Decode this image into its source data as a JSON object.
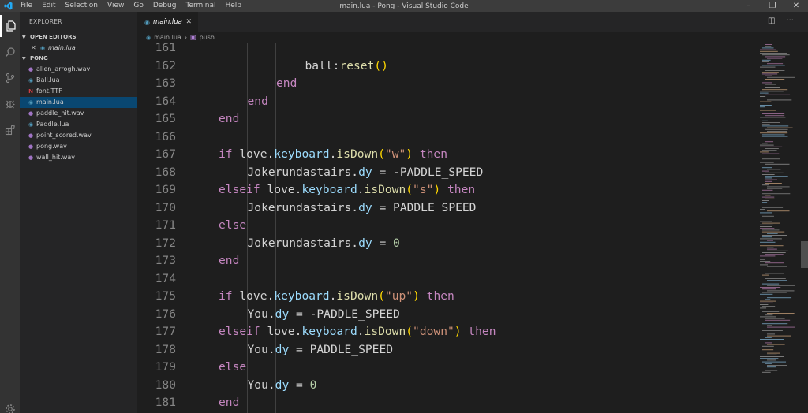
{
  "window": {
    "title": "main.lua - Pong - Visual Studio Code",
    "menu": [
      "File",
      "Edit",
      "Selection",
      "View",
      "Go",
      "Debug",
      "Terminal",
      "Help"
    ]
  },
  "activity_bar": {
    "items": [
      "files-icon",
      "search-icon",
      "source-control-icon",
      "debug-icon",
      "extensions-icon",
      "settings-gear-icon"
    ]
  },
  "sidebar": {
    "title": "EXPLORER",
    "open_editors": {
      "label": "OPEN EDITORS",
      "items": [
        {
          "name": "main.lua",
          "icon": "lua-file-icon"
        }
      ]
    },
    "folder": {
      "label": "PONG",
      "files": [
        {
          "name": "allen_arrogh.wav",
          "icon": "audio-file-icon",
          "selected": false
        },
        {
          "name": "Ball.lua",
          "icon": "lua-file-icon",
          "selected": false
        },
        {
          "name": "font.TTF",
          "icon": "font-file-icon",
          "selected": false
        },
        {
          "name": "main.lua",
          "icon": "lua-file-icon",
          "selected": true
        },
        {
          "name": "paddle_hit.wav",
          "icon": "audio-file-icon",
          "selected": false
        },
        {
          "name": "Paddle.lua",
          "icon": "lua-file-icon",
          "selected": false
        },
        {
          "name": "point_scored.wav",
          "icon": "audio-file-icon",
          "selected": false
        },
        {
          "name": "pong.wav",
          "icon": "audio-file-icon",
          "selected": false
        },
        {
          "name": "wall_hit.wav",
          "icon": "audio-file-icon",
          "selected": false
        }
      ]
    }
  },
  "tabs": [
    {
      "label": "main.lua",
      "active": true
    }
  ],
  "breadcrumb": {
    "file": "main.lua",
    "symbol": "push"
  },
  "editor": {
    "lines": [
      {
        "n": "161",
        "indent": 3,
        "tokens": []
      },
      {
        "n": "162",
        "indent": 3,
        "tokens": [
          [
            "t",
            "ball:"
          ],
          [
            "fnc",
            "reset"
          ],
          [
            "paren",
            "()"
          ]
        ]
      },
      {
        "n": "163",
        "indent": 2,
        "tokens": [
          [
            "kw",
            "end"
          ]
        ]
      },
      {
        "n": "164",
        "indent": 1,
        "tokens": [
          [
            "kw",
            "end"
          ]
        ]
      },
      {
        "n": "165",
        "indent": 0,
        "tokens": [
          [
            "kw",
            "end"
          ]
        ]
      },
      {
        "n": "166",
        "indent": 0,
        "tokens": []
      },
      {
        "n": "167",
        "indent": 0,
        "tokens": [
          [
            "kw",
            "if"
          ],
          [
            "t",
            " love."
          ],
          [
            "prop",
            "keyboard"
          ],
          [
            "t",
            "."
          ],
          [
            "fnc",
            "isDown"
          ],
          [
            "paren",
            "("
          ],
          [
            "str",
            "\"w\""
          ],
          [
            "paren",
            ")"
          ],
          [
            "t",
            " "
          ],
          [
            "kw",
            "then"
          ]
        ]
      },
      {
        "n": "168",
        "indent": 1,
        "tokens": [
          [
            "t",
            "Jokerundastairs."
          ],
          [
            "prop",
            "dy"
          ],
          [
            "t",
            " = -PADDLE_SPEED"
          ]
        ]
      },
      {
        "n": "169",
        "indent": 0,
        "tokens": [
          [
            "kw",
            "elseif"
          ],
          [
            "t",
            " love."
          ],
          [
            "prop",
            "keyboard"
          ],
          [
            "t",
            "."
          ],
          [
            "fnc",
            "isDown"
          ],
          [
            "paren",
            "("
          ],
          [
            "str",
            "\"s\""
          ],
          [
            "paren",
            ")"
          ],
          [
            "t",
            " "
          ],
          [
            "kw",
            "then"
          ]
        ]
      },
      {
        "n": "170",
        "indent": 1,
        "tokens": [
          [
            "t",
            "Jokerundastairs."
          ],
          [
            "prop",
            "dy"
          ],
          [
            "t",
            " = PADDLE_SPEED"
          ]
        ]
      },
      {
        "n": "171",
        "indent": 0,
        "tokens": [
          [
            "kw",
            "else"
          ]
        ]
      },
      {
        "n": "172",
        "indent": 1,
        "tokens": [
          [
            "t",
            "Jokerundastairs."
          ],
          [
            "prop",
            "dy"
          ],
          [
            "t",
            " = "
          ],
          [
            "num",
            "0"
          ]
        ]
      },
      {
        "n": "173",
        "indent": 0,
        "tokens": [
          [
            "kw",
            "end"
          ]
        ]
      },
      {
        "n": "174",
        "indent": 0,
        "tokens": []
      },
      {
        "n": "175",
        "indent": 0,
        "tokens": [
          [
            "kw",
            "if"
          ],
          [
            "t",
            " love."
          ],
          [
            "prop",
            "keyboard"
          ],
          [
            "t",
            "."
          ],
          [
            "fnc",
            "isDown"
          ],
          [
            "paren",
            "("
          ],
          [
            "str",
            "\"up\""
          ],
          [
            "paren",
            ")"
          ],
          [
            "t",
            " "
          ],
          [
            "kw",
            "then"
          ]
        ]
      },
      {
        "n": "176",
        "indent": 1,
        "tokens": [
          [
            "t",
            "You."
          ],
          [
            "prop",
            "dy"
          ],
          [
            "t",
            " = -PADDLE_SPEED"
          ]
        ]
      },
      {
        "n": "177",
        "indent": 0,
        "tokens": [
          [
            "kw",
            "elseif"
          ],
          [
            "t",
            " love."
          ],
          [
            "prop",
            "keyboard"
          ],
          [
            "t",
            "."
          ],
          [
            "fnc",
            "isDown"
          ],
          [
            "paren",
            "("
          ],
          [
            "str",
            "\"down\""
          ],
          [
            "paren",
            ")"
          ],
          [
            "t",
            " "
          ],
          [
            "kw",
            "then"
          ]
        ]
      },
      {
        "n": "178",
        "indent": 1,
        "tokens": [
          [
            "t",
            "You."
          ],
          [
            "prop",
            "dy"
          ],
          [
            "t",
            " = PADDLE_SPEED"
          ]
        ]
      },
      {
        "n": "179",
        "indent": 0,
        "tokens": [
          [
            "kw",
            "else"
          ]
        ]
      },
      {
        "n": "180",
        "indent": 1,
        "tokens": [
          [
            "t",
            "You."
          ],
          [
            "prop",
            "dy"
          ],
          [
            "t",
            " = "
          ],
          [
            "num",
            "0"
          ]
        ]
      },
      {
        "n": "181",
        "indent": 0,
        "tokens": [
          [
            "kw",
            "end"
          ]
        ]
      }
    ]
  },
  "colors": {
    "keyword": "#c586c0",
    "function": "#dcdcaa",
    "string": "#ce9178",
    "number": "#b5cea8",
    "property": "#9cdcfe",
    "bracket": "#ffd700",
    "selection": "#094771"
  }
}
